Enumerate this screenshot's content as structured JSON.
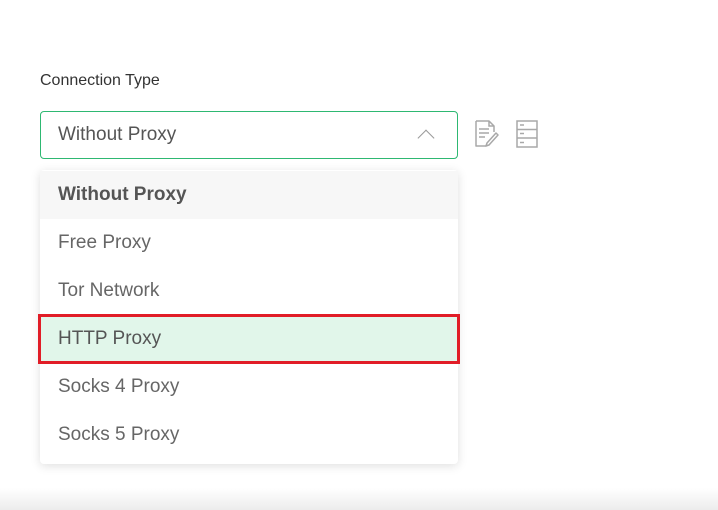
{
  "connection": {
    "label": "Connection Type",
    "selected_value": "Without Proxy",
    "options": [
      {
        "label": "Without Proxy"
      },
      {
        "label": "Free Proxy"
      },
      {
        "label": "Tor Network"
      },
      {
        "label": "HTTP Proxy"
      },
      {
        "label": "Socks 4 Proxy"
      },
      {
        "label": "Socks 5 Proxy"
      }
    ]
  },
  "icons": {
    "edit": "edit-list-icon",
    "server": "server-icon",
    "chevron": "chevron-up-icon"
  },
  "colors": {
    "accent": "#2eb872",
    "hover_bg": "#e1f6ea",
    "highlight": "#e11d27"
  }
}
